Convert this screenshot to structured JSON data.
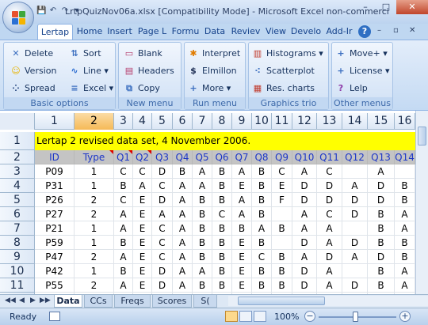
{
  "window": {
    "title": "LrtpQuizNov06a.xlsx  [Compatibility Mode] - Microsoft Excel non-commerci",
    "controls": [
      "–",
      "□",
      "✕"
    ]
  },
  "qat": [
    "💾",
    "↶",
    "↷",
    "▾"
  ],
  "tabs": [
    "Lertap",
    "Home",
    "Insert",
    "Page L",
    "Formu",
    "Data",
    "Reviev",
    "View",
    "Develo",
    "Add-Ir"
  ],
  "ribbon": {
    "groups": [
      {
        "label": "Basic options",
        "buttons": [
          {
            "label": "Delete",
            "icon": "✕",
            "color": "#3c6fc0"
          },
          {
            "label": "Sort",
            "icon": "⇅",
            "color": "#3c6fc0"
          },
          {
            "label": "Version",
            "icon": "☺",
            "color": "#e8b400"
          },
          {
            "label": "Line ▾",
            "icon": "∿",
            "color": "#2f6fd1"
          },
          {
            "label": "Spread",
            "icon": "⁘",
            "color": "#1e3f7a"
          },
          {
            "label": "Excel ▾",
            "icon": "≡",
            "color": "#3c6fc0"
          }
        ]
      },
      {
        "label": "New menu",
        "buttons": [
          {
            "label": "Blank",
            "icon": "▭",
            "color": "#b43a6a"
          },
          {
            "label": "Headers",
            "icon": "▤",
            "color": "#b43a6a"
          },
          {
            "label": "Copy",
            "icon": "⧉",
            "color": "#3c6fc0"
          }
        ]
      },
      {
        "label": "Run menu",
        "buttons": [
          {
            "label": "Interpret",
            "icon": "✱",
            "color": "#e07b00"
          },
          {
            "label": "Elmillon",
            "icon": "$",
            "color": "#1e2f55"
          },
          {
            "label": "More ▾",
            "icon": "+",
            "color": "#3c6fc0"
          }
        ]
      },
      {
        "label": "Graphics trio",
        "buttons": [
          {
            "label": "Histograms ▾",
            "icon": "▥",
            "color": "#c0392b"
          },
          {
            "label": "Scatterplot",
            "icon": "⁖",
            "color": "#3c6fc0"
          },
          {
            "label": "Res. charts",
            "icon": "▦",
            "color": "#c0392b"
          }
        ]
      },
      {
        "label": "Other menus",
        "buttons": [
          {
            "label": "Move+ ▾",
            "icon": "+",
            "color": "#3c6fc0"
          },
          {
            "label": "License ▾",
            "icon": "+",
            "color": "#3c6fc0"
          },
          {
            "label": "Lelp",
            "icon": "?",
            "color": "#8e3aa8"
          }
        ]
      }
    ]
  },
  "col_headers": [
    "1",
    "2",
    "3",
    "4",
    "5",
    "6",
    "7",
    "8",
    "9",
    "10",
    "11",
    "12",
    "13",
    "14",
    "15",
    "16"
  ],
  "row_headers": [
    "1",
    "2",
    "3",
    "4",
    "5",
    "6",
    "7",
    "8",
    "9",
    "10",
    "11",
    "12"
  ],
  "row1_text": "Lertap 2 revised data set, 4 November 2006.",
  "header_row": [
    "ID",
    "Type",
    "Q1",
    "Q2",
    "Q3",
    "Q4",
    "Q5",
    "Q6",
    "Q7",
    "Q8",
    "Q9",
    "Q10",
    "Q11",
    "Q12",
    "Q13",
    "Q14"
  ],
  "rows": [
    [
      "P09",
      "1",
      "C",
      "C",
      "D",
      "B",
      "A",
      "B",
      "A",
      "B",
      "C",
      "A",
      "C",
      "",
      "A",
      ""
    ],
    [
      "P31",
      "1",
      "B",
      "A",
      "C",
      "A",
      "A",
      "B",
      "E",
      "B",
      "E",
      "D",
      "D",
      "A",
      "D",
      "B"
    ],
    [
      "P26",
      "2",
      "C",
      "E",
      "D",
      "A",
      "B",
      "B",
      "A",
      "B",
      "F",
      "D",
      "D",
      "D",
      "D",
      "B"
    ],
    [
      "P27",
      "2",
      "A",
      "E",
      "A",
      "A",
      "B",
      "C",
      "A",
      "B",
      "",
      "A",
      "C",
      "D",
      "B",
      "A"
    ],
    [
      "P21",
      "1",
      "A",
      "E",
      "C",
      "A",
      "B",
      "B",
      "B",
      "A",
      "B",
      "A",
      "A",
      "",
      "B",
      "A"
    ],
    [
      "P59",
      "1",
      "B",
      "E",
      "C",
      "A",
      "B",
      "B",
      "E",
      "B",
      "",
      "D",
      "A",
      "D",
      "B",
      "B"
    ],
    [
      "P47",
      "2",
      "A",
      "E",
      "C",
      "A",
      "B",
      "B",
      "E",
      "C",
      "B",
      "A",
      "D",
      "A",
      "D",
      "B"
    ],
    [
      "P42",
      "1",
      "B",
      "E",
      "D",
      "A",
      "A",
      "B",
      "E",
      "B",
      "B",
      "D",
      "A",
      "",
      "B",
      "A"
    ],
    [
      "P55",
      "2",
      "A",
      "E",
      "D",
      "A",
      "B",
      "B",
      "E",
      "B",
      "B",
      "D",
      "A",
      "D",
      "B",
      "A"
    ],
    [
      "P51",
      "2",
      "A",
      "E",
      "C",
      "A",
      "B",
      "B",
      "E",
      "B",
      "B",
      "D",
      "A",
      "D",
      "B",
      "A"
    ]
  ],
  "sheet_tabs": [
    "Data",
    "CCs",
    "Freqs",
    "Scores",
    "S("
  ],
  "status": {
    "ready": "Ready",
    "zoom": "100%"
  }
}
